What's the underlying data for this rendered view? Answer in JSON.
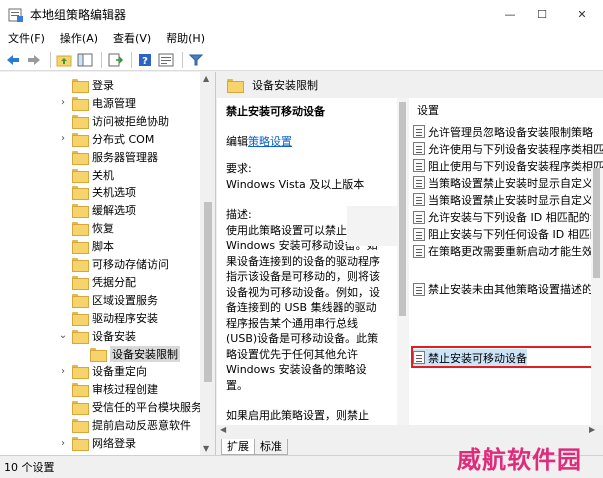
{
  "window": {
    "title": "本地组策略编辑器",
    "minimize_glyph": "—",
    "maximize_glyph": "☐",
    "close_glyph": "✕"
  },
  "menu": [
    "文件(F)",
    "操作(A)",
    "查看(V)",
    "帮助(H)"
  ],
  "toolbar": {
    "icons": [
      "back-icon",
      "forward-icon",
      "up-folder-icon",
      "show-tree-icon",
      "export-icon",
      "help-icon",
      "properties-icon",
      "filter-icon"
    ]
  },
  "tree": {
    "items": [
      {
        "label": "登录",
        "expandable": false,
        "level": 1
      },
      {
        "label": "电源管理",
        "expandable": true,
        "level": 1
      },
      {
        "label": "访问被拒绝协助",
        "expandable": false,
        "level": 1
      },
      {
        "label": "分布式 COM",
        "expandable": true,
        "level": 1
      },
      {
        "label": "服务器管理器",
        "expandable": false,
        "level": 1
      },
      {
        "label": "关机",
        "expandable": false,
        "level": 1
      },
      {
        "label": "关机选项",
        "expandable": false,
        "level": 1
      },
      {
        "label": "缓解选项",
        "expandable": false,
        "level": 1
      },
      {
        "label": "恢复",
        "expandable": false,
        "level": 1
      },
      {
        "label": "脚本",
        "expandable": false,
        "level": 1
      },
      {
        "label": "可移动存储访问",
        "expandable": false,
        "level": 1
      },
      {
        "label": "凭据分配",
        "expandable": false,
        "level": 1
      },
      {
        "label": "区域设置服务",
        "expandable": false,
        "level": 1
      },
      {
        "label": "驱动程序安装",
        "expandable": false,
        "level": 1
      },
      {
        "label": "设备安装",
        "expandable": true,
        "expanded": true,
        "level": 1
      },
      {
        "label": "设备安装限制",
        "expandable": false,
        "level": 2,
        "selected": true
      },
      {
        "label": "设备重定向",
        "expandable": true,
        "level": 1
      },
      {
        "label": "审核过程创建",
        "expandable": false,
        "level": 1
      },
      {
        "label": "受信任的平台模块服务",
        "expandable": false,
        "level": 1
      },
      {
        "label": "提前启动反恶意软件",
        "expandable": false,
        "level": 1
      },
      {
        "label": "网络登录",
        "expandable": true,
        "level": 1
      }
    ]
  },
  "breadcrumb": {
    "current": "设备安装限制"
  },
  "description": {
    "title": "禁止安装可移动设备",
    "edit_prefix": "编辑",
    "edit_link": "策略设置",
    "requirements_label": "要求:",
    "requirements_value": "Windows Vista 及以上版本",
    "description_label": "描述:",
    "para1": "使用此策略设置可以禁止 Windows 安装可移动设备。如果设备连接到的设备的驱动程序指示该设备是可移动的，则将该设备视为可移动设备。例如，设备连接到的 USB 集线器的驱动程序报告某个通用串行总线(USB)设备是可移动设备。此策略设置优先于任何其他允许 Windows 安装设备的策略设置。",
    "para2": "如果启用此策略设置，则禁止 Windows 安装可移动设备，并且不能更新现有可移动设备的驱动程序。"
  },
  "settings": {
    "header": "设置",
    "items": [
      "允许管理员忽略设备安装限制策略",
      "允许使用与下列设备安装程序类相匹配的驱动程序安装设备",
      "阻止使用与下列设备安装程序类相匹配的驱动程序安装设备",
      "当策略设置禁止安装时显示自定义消息(标题)",
      "当策略设置禁止安装时显示自定义消息(正文)",
      "允许安装与下列设备 ID 相匹配的设备",
      "阻止安装与下列任何设备 ID 相匹配的设备",
      "在策略更改需要重新启动才能生效时计时",
      "禁止安装可移动设备",
      "禁止安装未由其他策略设置描述的设备"
    ],
    "highlighted_index": 8
  },
  "tabs": [
    "扩展",
    "标准"
  ],
  "active_tab": 0,
  "status": {
    "text": "10 个设置"
  },
  "watermark": "威航软件园",
  "colors": {
    "highlight_border": "#e02020",
    "link": "#0b62c8",
    "watermark": "#e02a7a"
  }
}
